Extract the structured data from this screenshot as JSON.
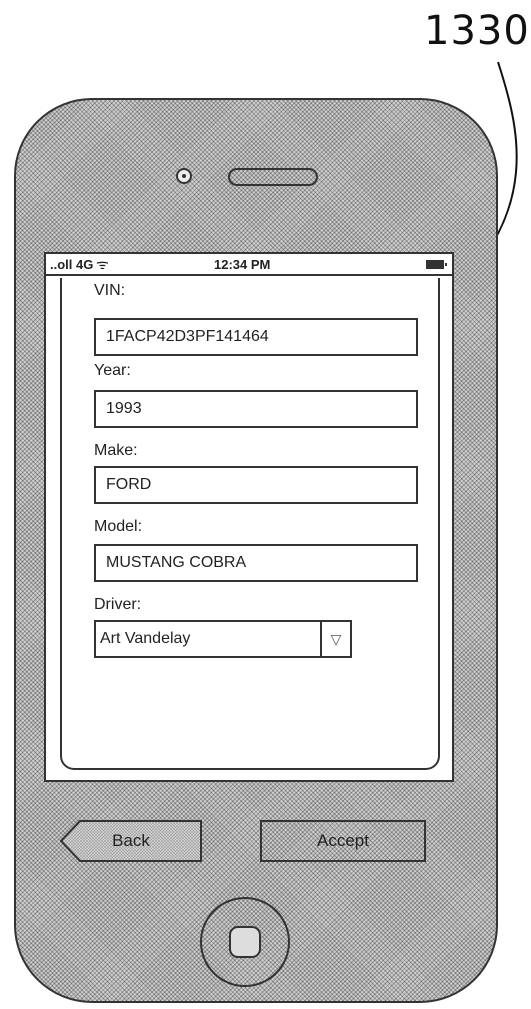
{
  "figure": {
    "reference_numeral": "1330"
  },
  "status_bar": {
    "signal": "..oll 4G",
    "wifi_glyph": "ᯤ",
    "time": "12:34 PM"
  },
  "form": {
    "vin": {
      "label": "VIN:",
      "value": "1FACP42D3PF141464"
    },
    "year": {
      "label": "Year:",
      "value": "1993"
    },
    "make": {
      "label": "Make:",
      "value": "FORD"
    },
    "model": {
      "label": "Model:",
      "value": "MUSTANG COBRA"
    },
    "driver": {
      "label": "Driver:",
      "value": "Art Vandelay",
      "arrow_glyph": "▽"
    }
  },
  "buttons": {
    "back_label": "Back",
    "accept_label": "Accept"
  }
}
